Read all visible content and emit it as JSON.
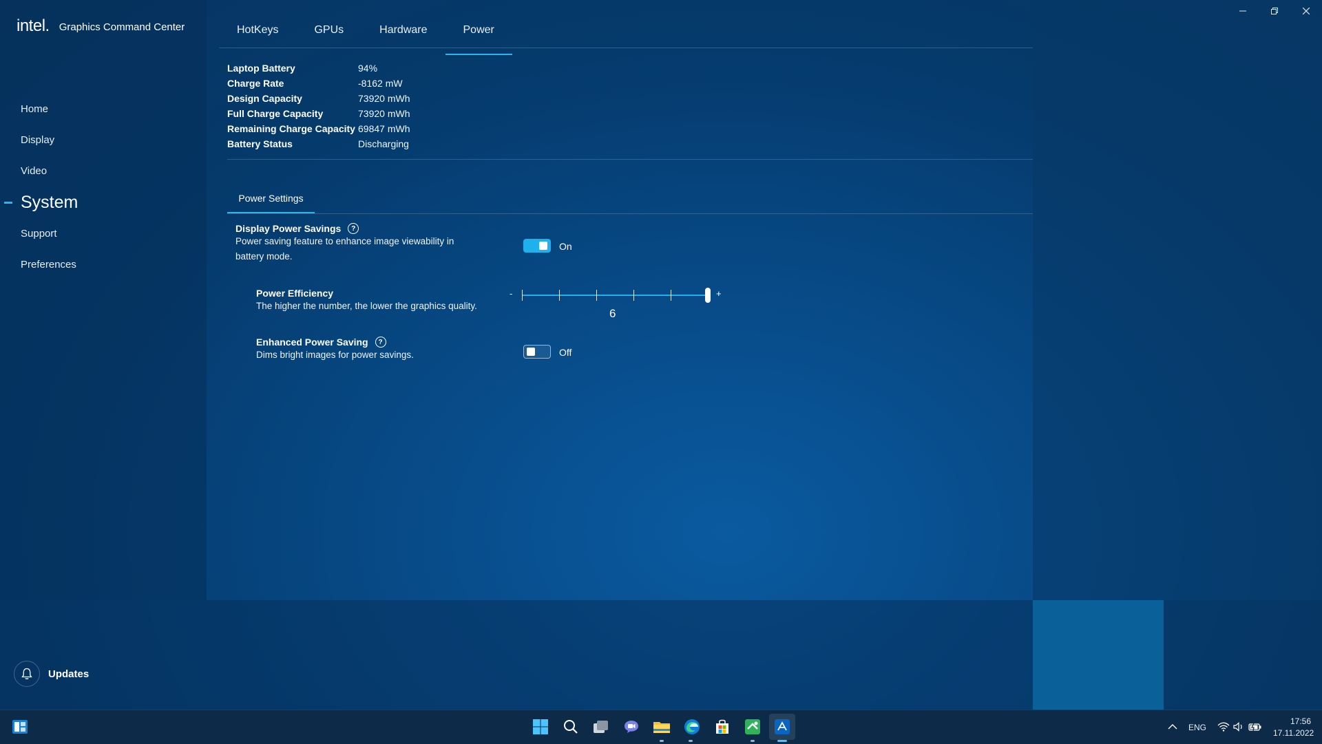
{
  "window": {
    "brand_logo": "intel.",
    "app_name": "Graphics Command Center"
  },
  "sidebar": {
    "items": [
      {
        "label": "Home"
      },
      {
        "label": "Display"
      },
      {
        "label": "Video"
      },
      {
        "label": "System"
      },
      {
        "label": "Support"
      },
      {
        "label": "Preferences"
      }
    ],
    "active": "System",
    "updates_label": "Updates"
  },
  "tabs": [
    {
      "label": "HotKeys"
    },
    {
      "label": "GPUs"
    },
    {
      "label": "Hardware"
    },
    {
      "label": "Power"
    }
  ],
  "active_tab": "Power",
  "battery": {
    "rows": [
      {
        "label": "Laptop Battery",
        "value": "94%"
      },
      {
        "label": "Charge Rate",
        "value": "-8162 mW"
      },
      {
        "label": "Design Capacity",
        "value": "73920 mWh"
      },
      {
        "label": "Full Charge Capacity",
        "value": "73920 mWh"
      },
      {
        "label": "Remaining Charge Capacity",
        "value": "69847 mWh"
      },
      {
        "label": "Battery Status",
        "value": "Discharging"
      }
    ]
  },
  "power_settings": {
    "tab_label": "Power Settings",
    "display_power_savings": {
      "title": "Display Power Savings",
      "description": "Power saving feature to enhance image viewability in battery mode.",
      "state_label": "On",
      "enabled": true
    },
    "power_efficiency": {
      "title": "Power Efficiency",
      "description": "The higher the number, the lower the graphics quality.",
      "min_symbol": "-",
      "max_symbol": "+",
      "value": "6",
      "min": 1,
      "max": 6
    },
    "enhanced_power_saving": {
      "title": "Enhanced Power Saving",
      "description": "Dims bright images for power savings.",
      "state_label": "Off",
      "enabled": false
    }
  },
  "taskbar": {
    "language": "ENG",
    "time": "17:56",
    "date": "17.11.2022"
  },
  "colors": {
    "accent": "#1fb1ee",
    "background": "#074985"
  }
}
